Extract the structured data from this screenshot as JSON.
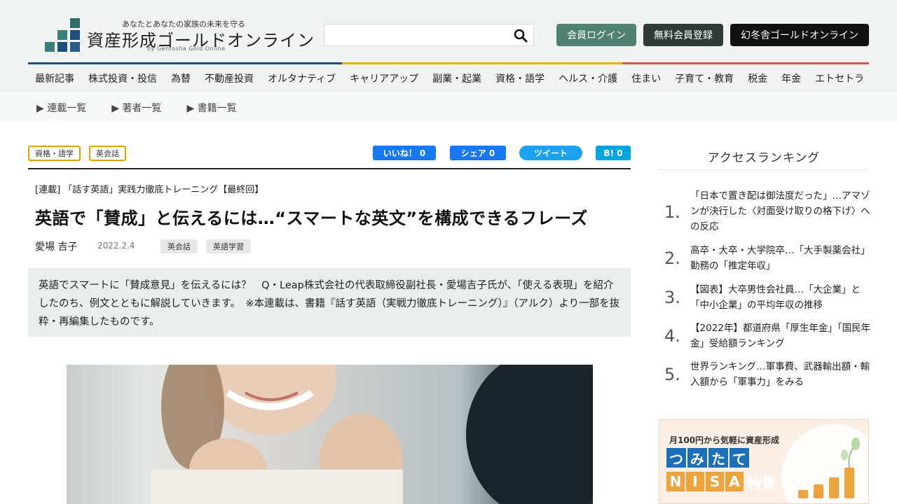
{
  "header": {
    "tagline": "あなたとあなたの家族の未来を守る",
    "site_title": "資産形成ゴールドオンライン",
    "site_subtitle": "by Gentosha Gold Online",
    "search_placeholder": "",
    "buttons": {
      "login": "会員ログイン",
      "register": "無料会員登録",
      "gentosha": "幻冬舎ゴールドオンライン"
    }
  },
  "nav": {
    "items": [
      "最新記事",
      "株式投資・投信",
      "為替",
      "不動産投資",
      "オルタナティブ",
      "キャリアアップ",
      "副業・起業",
      "資格・語学",
      "ヘルス・介護",
      "住まい",
      "子育て・教育",
      "税金",
      "年金",
      "エトセトラ"
    ],
    "sub_items": [
      "▶ 連載一覧",
      "▶ 著者一覧",
      "▶ 書籍一覧"
    ]
  },
  "article": {
    "category_tags": [
      "資格・語学",
      "英会話"
    ],
    "share": {
      "like": "いいね！ 0",
      "share": "シェア 0",
      "tweet": "ツイート",
      "hatena": "B! 0"
    },
    "series": "[連載] 「話す英語」実践力徹底トレーニング【最終回】",
    "title": "英語で「賛成」と伝えるには…“スマートな英文”を構成できるフレーズ",
    "author": "愛場 吉子",
    "date": "2022.2.4",
    "keywords": [
      "英会話",
      "英語学習"
    ],
    "lead": "英語でスマートに「賛成意見」を伝えるには？　Q・Leap株式会社の代表取締役副社長・愛場吉子氏が、「使える表現」を紹介したのち、例文とともに解説していきます。　※本連載は、書籍『話す英語（実戦力徹底トレーニング）』（アルク）より一部を抜粋・再編集したものです。"
  },
  "sidebar": {
    "ranking_title": "アクセスランキング",
    "ranking": [
      {
        "num": "1.",
        "text": "「日本で置き配は御法度だった」…アマゾンが決行した〈対面受け取りの格下げ〉への反応"
      },
      {
        "num": "2.",
        "text": "高卒・大卒・大学院卒…「大手製薬会社」勤務の「推定年収」"
      },
      {
        "num": "3.",
        "text": "【図表】大卒男性会社員…「大企業」と「中小企業」の平均年収の推移"
      },
      {
        "num": "4.",
        "text": "【2022年】都道府県「厚生年金」「国民年金」受給額ランキング"
      },
      {
        "num": "5.",
        "text": "世界ランキング…軍事費、武器輸出額・輸入額から「軍事力」をみる"
      }
    ],
    "banner": {
      "top_text": "月100円から気軽に資産形成",
      "row1": [
        "つ",
        "み",
        "た",
        "て"
      ],
      "row2": [
        "N",
        "I",
        "S",
        "A"
      ],
      "suffix": "特集"
    }
  },
  "colors": {
    "accent_teal": "#4e8172",
    "tag_border": "#e2a300",
    "facebook": "#1877f2",
    "twitter": "#1da1f2",
    "hatena": "#00a4de"
  }
}
